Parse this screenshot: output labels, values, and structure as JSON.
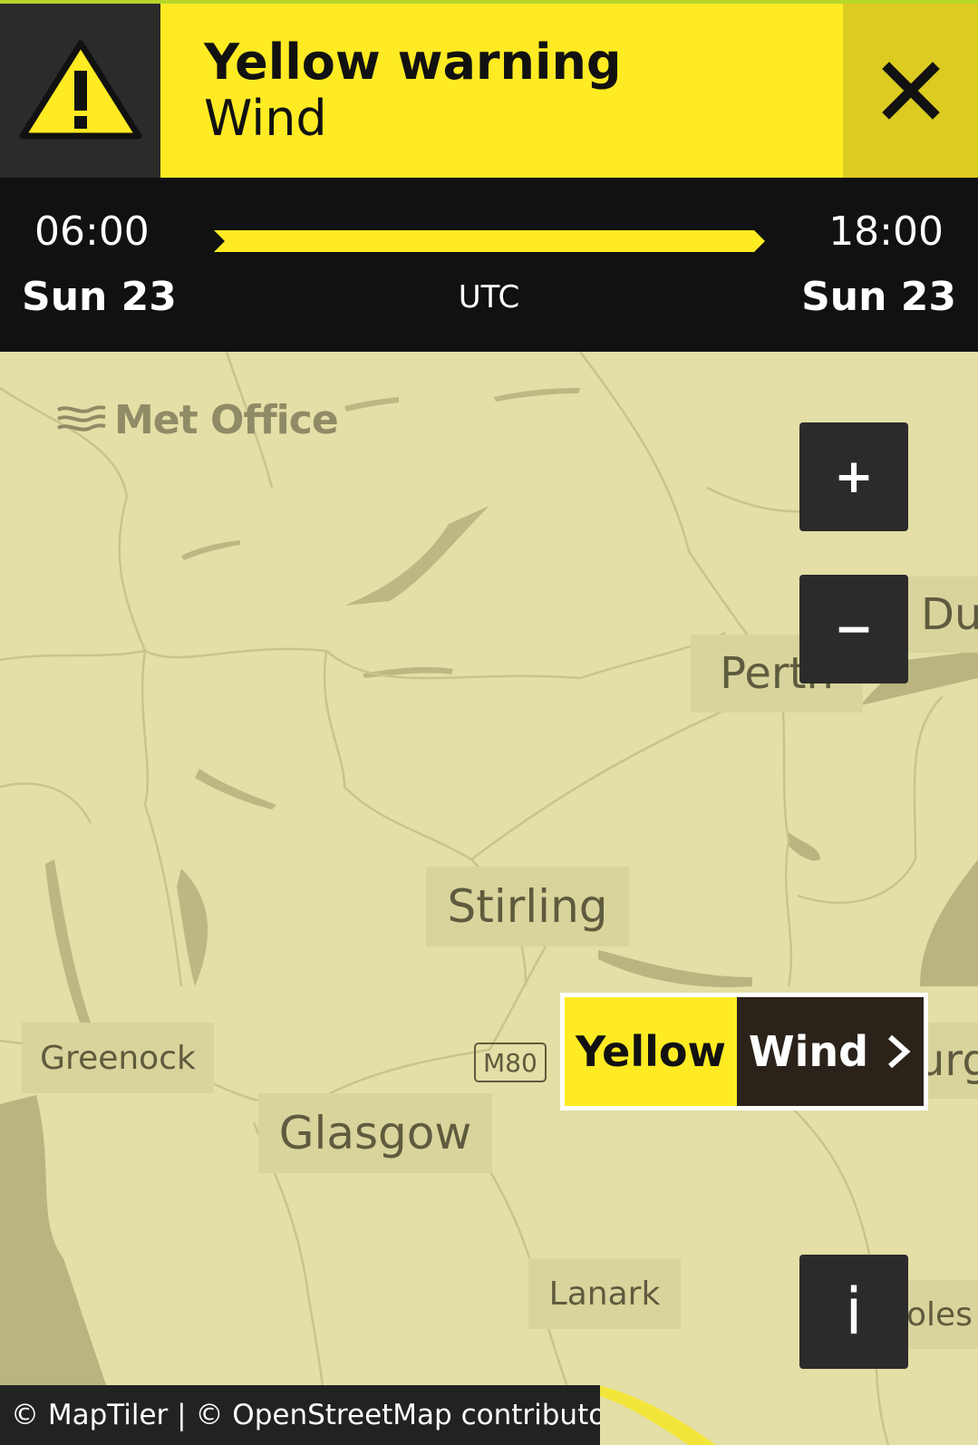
{
  "warning": {
    "level": "Yellow warning",
    "type": "Wind",
    "level_color": "#ffeb23"
  },
  "timeline": {
    "start_time": "06:00",
    "start_day": "Sun 23",
    "end_time": "18:00",
    "end_day": "Sun 23",
    "timezone": "UTC"
  },
  "map": {
    "provider_logo": "Met Office",
    "places": {
      "perth": "Perth",
      "dundee_partial": "Du",
      "stirling": "Stirling",
      "greenock": "Greenock",
      "glasgow": "Glasgow",
      "lanark": "Lanark",
      "edinburgh_partial": "urg",
      "peebles_partial": "oles"
    },
    "road_label": "M80",
    "controls": {
      "zoom_in": "+",
      "zoom_out": "−",
      "info": "i"
    },
    "badge": {
      "level": "Yellow",
      "type": "Wind"
    },
    "attribution": "© MapTiler | © OpenStreetMap contributors"
  },
  "icons": [
    "warning-triangle-icon",
    "close-icon",
    "chevron-right-icon",
    "met-office-logo-icon"
  ]
}
